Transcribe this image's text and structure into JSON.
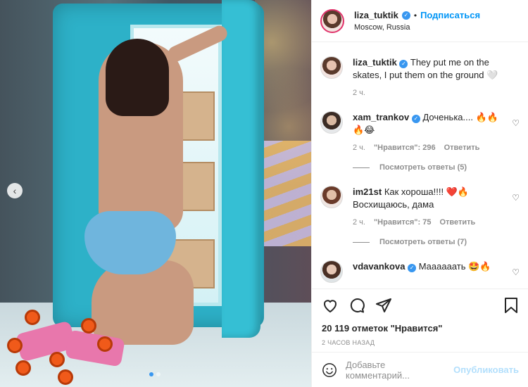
{
  "post": {
    "author": "liza_tuktik",
    "follow_label": "Подписаться",
    "separator": "•",
    "location": "Moscow, Russia"
  },
  "caption": {
    "author": "liza_tuktik",
    "text": "They put me on the skates, I put them on the ground 🤍",
    "time": "2 ч."
  },
  "comments": [
    {
      "author": "xam_trankov",
      "text": "Доченька.... 🔥🔥🔥😂",
      "time": "2 ч.",
      "likes": "\"Нравится\": 296",
      "reply": "Ответить",
      "replies": "Посмотреть ответы (5)"
    },
    {
      "author": "im21st",
      "text": "Как хороша!!!! ❤️🔥 Восхищаюсь, дама",
      "time": "2 ч.",
      "likes": "\"Нравится\": 75",
      "reply": "Ответить",
      "replies": "Посмотреть ответы (7)"
    },
    {
      "author": "vdavankova",
      "text": "Маааааать 🤩🔥"
    }
  ],
  "actions": {
    "likes": "20 119 отметок \"Нравится\"",
    "time": "2 ЧАСОВ НАЗАД"
  },
  "add_comment": {
    "placeholder": "Добавьте комментарий...",
    "publish": "Опубликовать"
  },
  "colors": {
    "accent": "#0095f6",
    "verified": "#3897f0",
    "muted": "#8e8e8e"
  }
}
